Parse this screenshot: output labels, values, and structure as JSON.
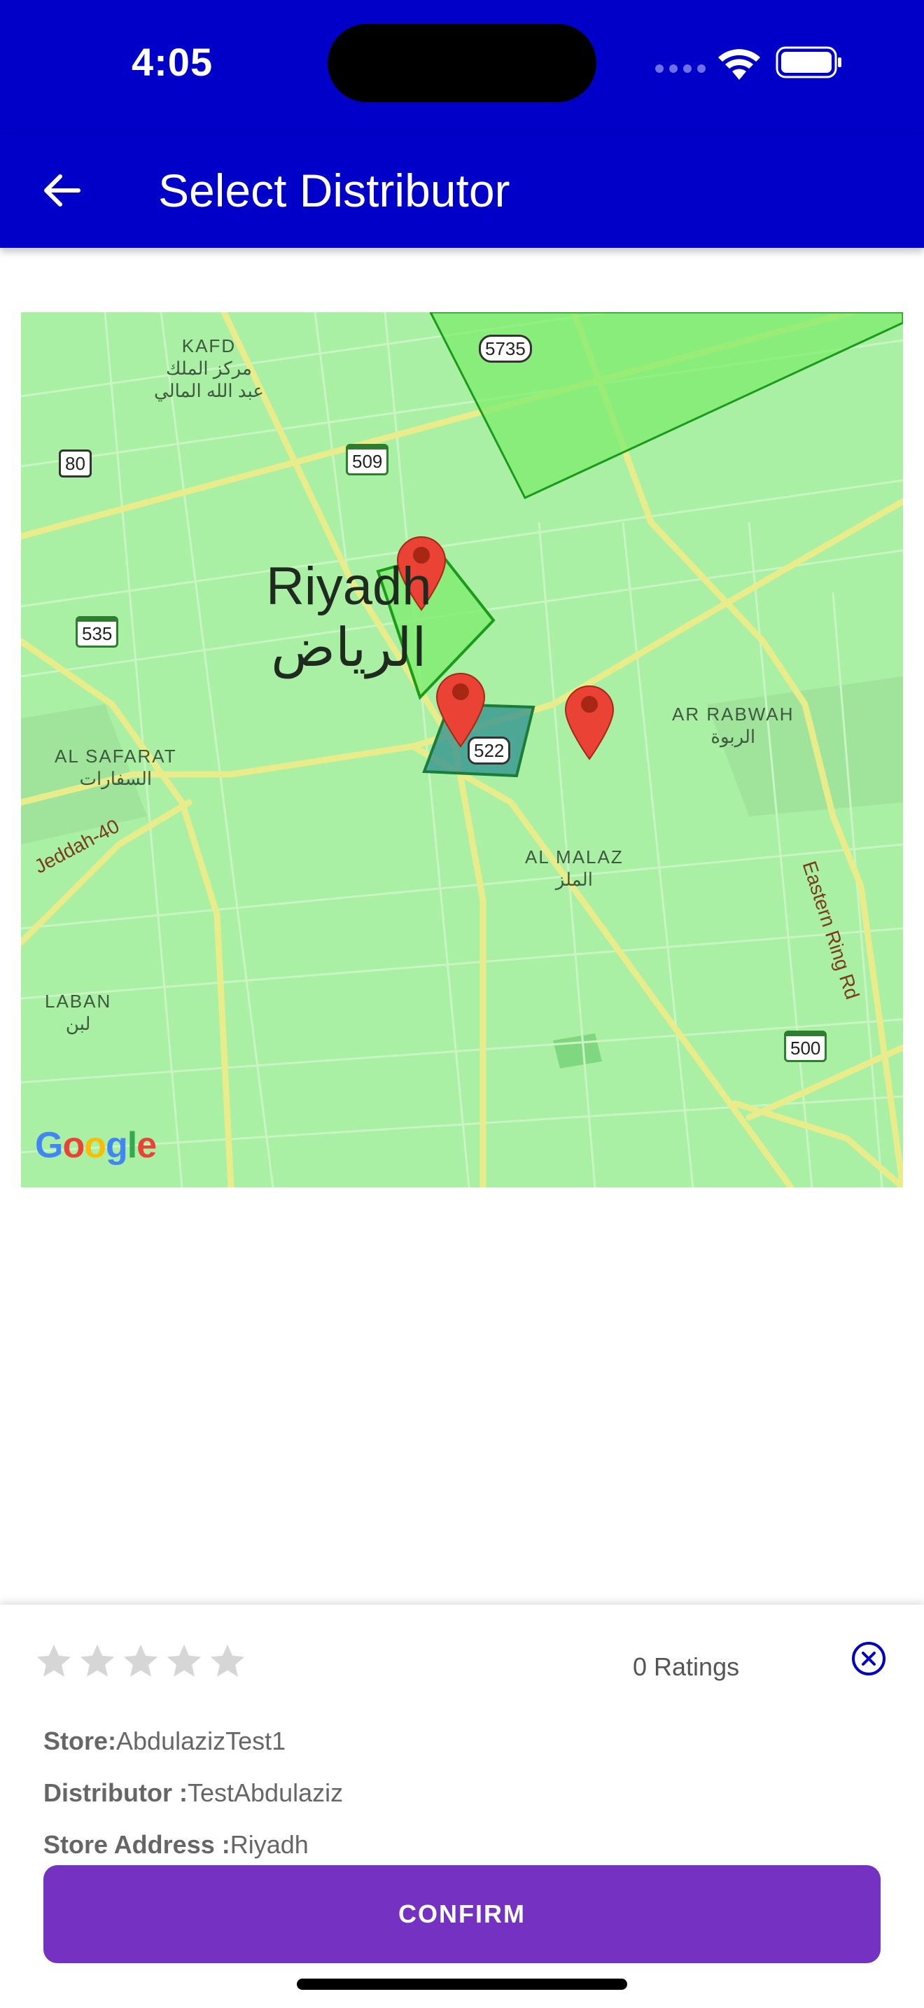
{
  "status_bar": {
    "time": "4:05"
  },
  "app_bar": {
    "title": "Select Distributor",
    "back_icon": "arrow-left-icon"
  },
  "map": {
    "city": {
      "en": "Riyadh",
      "ar": "الرياض"
    },
    "districts": [
      {
        "en": "KAFD",
        "ar": "مركز الملك\nعبد الله المالي"
      },
      {
        "en": "AR RABWAH",
        "ar": "الربوة"
      },
      {
        "en": "AL SAFARAT",
        "ar": "السفارات"
      },
      {
        "en": "AL MALAZ",
        "ar": "الملز"
      },
      {
        "en": "LABAN",
        "ar": "لبن"
      }
    ],
    "shields": [
      "5735",
      "80",
      "509",
      "535",
      "522",
      "500"
    ],
    "roads": [
      "Jeddah-40",
      "Eastern Ring Rd"
    ],
    "attribution": "Google",
    "markers": 3
  },
  "sheet": {
    "rating_stars": 0,
    "ratings_text": "0 Ratings",
    "close_icon": "close-circle-icon",
    "store_label": "Store:",
    "store_value": "AbdulazizTest1",
    "distributor_label": "Distributor :",
    "distributor_value": "TestAbdulaziz",
    "address_label": "Store Address :",
    "address_value": "Riyadh",
    "confirm_label": "CONFIRM"
  },
  "colors": {
    "app_bar": "#0000c8",
    "confirm": "#7431c2",
    "map_bg": "#a9efa4",
    "marker": "#ea4335"
  }
}
